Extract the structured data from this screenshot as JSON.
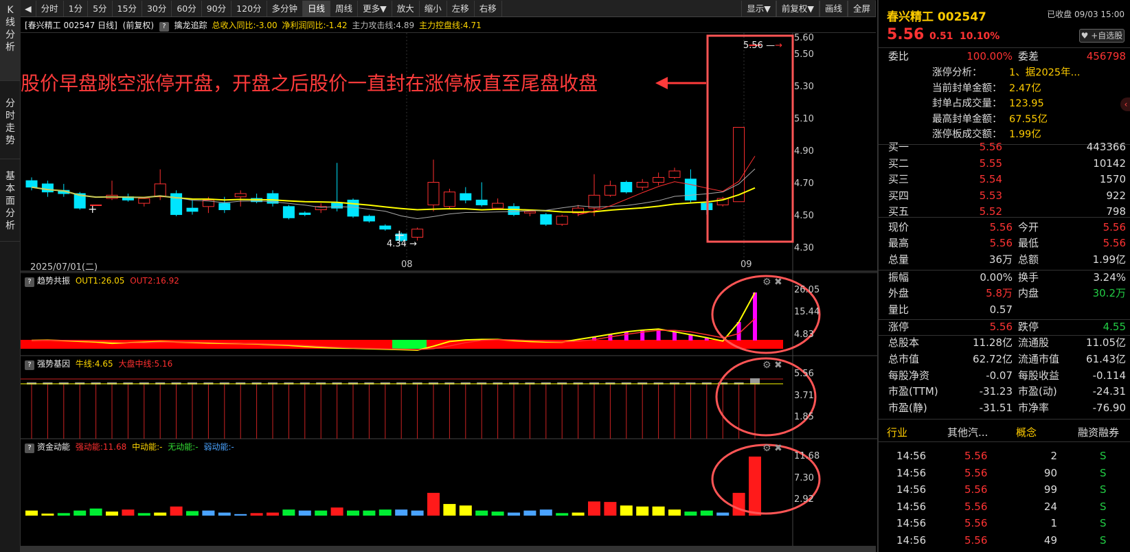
{
  "vtabs": [
    "K线分析",
    "分时走势",
    "基本面分析"
  ],
  "toolbar": {
    "left_arrow": "◀",
    "items": [
      "分时",
      "1分",
      "5分",
      "15分",
      "30分",
      "60分",
      "90分",
      "120分",
      "多分钟",
      "日线",
      "周线",
      "更多▼",
      "放大",
      "缩小",
      "左移",
      "右移"
    ],
    "active": "日线",
    "right_items": [
      "显示▼",
      "前复权▼",
      "画线",
      "全屏"
    ]
  },
  "infoline": {
    "stock": "[春兴精工 002547 日线]",
    "adj": "(前复权)",
    "ind": "擒龙追踪",
    "rev": "总收入同比:-3.00",
    "profit": "净利润同比:-1.42",
    "attack": "主力攻击线:4.89",
    "control": "主力控盘线:4.71"
  },
  "annotation": "股价早盘跳空涨停开盘，开盘之后股价一直封在涨停板直至尾盘收盘",
  "main_axis": [
    "5.60",
    "5.50",
    "5.30",
    "5.10",
    "4.90",
    "4.70",
    "4.50",
    "4.30"
  ],
  "date_labels": {
    "d1": "2025/07/01(二)",
    "d2": "08",
    "d3": "09"
  },
  "price_markers": {
    "high": "5.56",
    "low": "4.34"
  },
  "panels": {
    "p1": {
      "name": "趋势共振",
      "out1": "OUT1:26.05",
      "out2": "OUT2:16.92",
      "axis": [
        "26.05",
        "15.44",
        "4.83"
      ]
    },
    "p2": {
      "name": "强势基因",
      "bull": "牛线:4.65",
      "mid": "大盘中线:5.16",
      "axis": [
        "5.56",
        "3.71",
        "1.85"
      ]
    },
    "p3": {
      "name": "资金动能",
      "s": "强动能:11.68",
      "m": "中动能:-",
      "n": "无动能:-",
      "w": "弱动能:-",
      "axis": [
        "11.68",
        "7.30",
        "2.92"
      ]
    }
  },
  "colors": {
    "up": "#ff3030",
    "down": "#00e5ff",
    "ma_yellow": "#ffff00",
    "ma_red": "#ff3030",
    "ma_gray": "#aaaaaa",
    "highlight": "#ff5555"
  },
  "chart_data": {
    "type": "candlestick",
    "candles": [
      [
        4.72,
        4.68,
        4.74,
        4.66
      ],
      [
        4.7,
        4.65,
        4.72,
        4.62
      ],
      [
        4.66,
        4.64,
        4.7,
        4.62
      ],
      [
        4.64,
        4.55,
        4.65,
        4.54
      ],
      [
        4.57,
        4.57,
        4.57,
        4.57
      ],
      [
        4.61,
        4.63,
        4.72,
        4.6
      ],
      [
        4.62,
        4.6,
        4.64,
        4.59
      ],
      [
        4.58,
        4.61,
        4.62,
        4.56
      ],
      [
        4.62,
        4.7,
        4.79,
        4.6
      ],
      [
        4.64,
        4.51,
        4.66,
        4.5
      ],
      [
        4.55,
        4.53,
        4.6,
        4.51
      ],
      [
        4.56,
        4.6,
        4.62,
        4.52
      ],
      [
        4.58,
        4.54,
        4.62,
        4.52
      ],
      [
        4.62,
        4.64,
        4.66,
        4.56
      ],
      [
        4.61,
        4.59,
        4.64,
        4.58
      ],
      [
        4.64,
        4.58,
        4.66,
        4.56
      ],
      [
        4.56,
        4.49,
        4.57,
        4.48
      ],
      [
        4.52,
        4.51,
        4.53,
        4.5
      ],
      [
        4.54,
        4.56,
        4.58,
        4.52
      ],
      [
        4.58,
        4.55,
        4.83,
        4.53
      ],
      [
        4.6,
        4.5,
        4.61,
        4.49
      ],
      [
        4.5,
        4.47,
        4.51,
        4.46
      ],
      [
        4.44,
        4.42,
        4.45,
        4.41
      ],
      [
        4.39,
        4.35,
        4.4,
        4.34
      ],
      [
        4.37,
        4.42,
        4.43,
        4.35
      ],
      [
        4.57,
        4.71,
        4.85,
        4.53
      ],
      [
        4.56,
        4.65,
        4.67,
        4.55
      ],
      [
        4.64,
        4.6,
        4.68,
        4.58
      ],
      [
        4.6,
        4.57,
        4.71,
        4.56
      ],
      [
        4.55,
        4.58,
        4.61,
        4.55
      ],
      [
        4.56,
        4.51,
        4.58,
        4.5
      ],
      [
        4.52,
        4.53,
        4.54,
        4.5
      ],
      [
        4.51,
        4.45,
        4.52,
        4.44
      ],
      [
        4.45,
        4.5,
        4.51,
        4.44
      ],
      [
        4.52,
        4.55,
        4.57,
        4.5
      ],
      [
        4.55,
        4.63,
        4.76,
        4.5
      ],
      [
        4.63,
        4.69,
        4.72,
        4.62
      ],
      [
        4.71,
        4.65,
        4.72,
        4.64
      ],
      [
        4.68,
        4.71,
        4.73,
        4.66
      ],
      [
        4.71,
        4.74,
        4.77,
        4.69
      ],
      [
        4.74,
        4.78,
        4.8,
        4.73
      ],
      [
        4.73,
        4.6,
        4.79,
        4.58
      ],
      [
        4.58,
        4.54,
        4.61,
        4.51
      ],
      [
        4.57,
        4.61,
        4.62,
        4.56
      ],
      [
        4.59,
        5.05,
        5.05,
        4.59
      ],
      [
        5.56,
        5.56,
        5.56,
        5.56
      ]
    ],
    "ylim": [
      4.3,
      5.6
    ]
  },
  "right": {
    "title": "春兴精工 002547",
    "status": "已收盘 09/03 15:00",
    "price": "5.56",
    "change": "0.51",
    "pct": "10.10%",
    "fav": "♥ +自选股",
    "weibi_l": "委比",
    "weibi": "100.00%",
    "weicha_l": "委差",
    "weicha": "456798",
    "limit_info": [
      [
        "涨停分析：",
        "1、据2025年..."
      ],
      [
        "当前封单金额：",
        "2.47亿"
      ],
      [
        "封单占成交量：",
        "123.95"
      ],
      [
        "最高封单金额：",
        "67.55亿"
      ],
      [
        "涨停板成交额：",
        "1.99亿"
      ]
    ],
    "buys": [
      [
        "买一",
        "5.56",
        "443366"
      ],
      [
        "买二",
        "5.55",
        "10142"
      ],
      [
        "买三",
        "5.54",
        "1570"
      ],
      [
        "买四",
        "5.53",
        "922"
      ],
      [
        "买五",
        "5.52",
        "798"
      ]
    ],
    "stats": [
      [
        "现价",
        "5.56",
        "今开",
        "5.56"
      ],
      [
        "最高",
        "5.56",
        "最低",
        "5.56"
      ],
      [
        "总量",
        "36万",
        "总额",
        "1.99亿"
      ],
      [
        "振幅",
        "0.00%",
        "换手",
        "3.24%"
      ],
      [
        "外盘",
        "5.8万",
        "内盘",
        "30.2万"
      ],
      [
        "量比",
        "0.57",
        "",
        ""
      ],
      [
        "涨停",
        "5.56",
        "跌停",
        "4.55"
      ],
      [
        "总股本",
        "11.28亿",
        "流通股",
        "11.05亿"
      ],
      [
        "总市值",
        "62.72亿",
        "流通市值",
        "61.43亿"
      ],
      [
        "每股净资",
        "-0.07",
        "每股收益",
        "-0.114"
      ],
      [
        "市盈(TTM)",
        "-31.23",
        "市盈(动)",
        "-24.31"
      ],
      [
        "市盈(静)",
        "-31.51",
        "市净率",
        "-76.90"
      ]
    ],
    "tabs": [
      "行业",
      "其他汽...",
      "概念",
      "融资融券"
    ],
    "ticks": [
      [
        "14:56",
        "5.56",
        "2",
        "S"
      ],
      [
        "14:56",
        "5.56",
        "90",
        "S"
      ],
      [
        "14:56",
        "5.56",
        "99",
        "S"
      ],
      [
        "14:56",
        "5.56",
        "24",
        "S"
      ],
      [
        "14:56",
        "5.56",
        "1",
        "S"
      ],
      [
        "14:56",
        "5.56",
        "49",
        "S"
      ]
    ]
  }
}
